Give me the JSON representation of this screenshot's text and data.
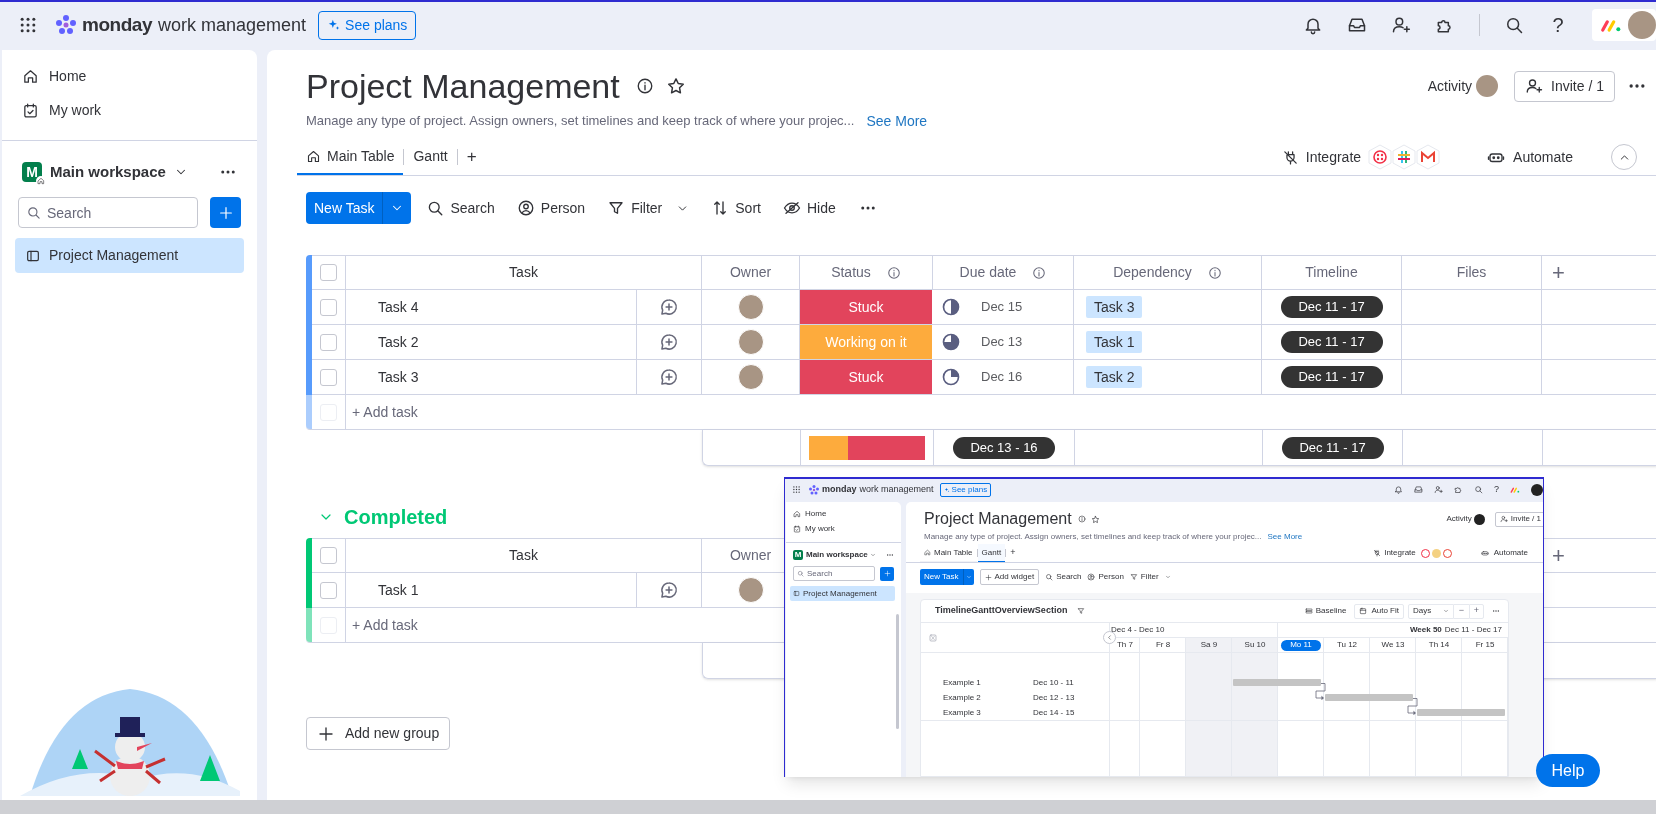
{
  "topbar": {
    "brand": "monday",
    "product": "work management",
    "see_plans": "See plans",
    "help": "?"
  },
  "sidebar": {
    "nav": [
      {
        "kind": "home",
        "label": "Home"
      },
      {
        "kind": "mywork",
        "label": "My work"
      }
    ],
    "workspace": {
      "badge": "M",
      "name": "Main workspace"
    },
    "search": {
      "placeholder": "Search"
    },
    "boards": [
      {
        "label": "Project Management",
        "selected": true
      }
    ]
  },
  "board": {
    "title": "Project Management",
    "description": "Manage any type of project. Assign owners, set timelines and keep track of where your projec...",
    "see_more": "See More",
    "activity": "Activity",
    "invite": "Invite / 1",
    "tabs": [
      {
        "label": "Main Table",
        "selected": true
      },
      {
        "label": "Gantt",
        "selected": false
      }
    ],
    "add_tab": "+",
    "integrate": "Integrate",
    "automate": "Automate",
    "toolbar": {
      "new_task": "New Task",
      "actions": [
        {
          "kind": "search",
          "label": "Search"
        },
        {
          "kind": "person",
          "label": "Person"
        },
        {
          "kind": "filter",
          "label": "Filter"
        },
        {
          "kind": "sort",
          "label": "Sort"
        },
        {
          "kind": "hide",
          "label": "Hide"
        }
      ]
    }
  },
  "groups": [
    {
      "color": "#579bfc",
      "checked": false,
      "add_row_checkbox_disabled": true,
      "columns": [
        {
          "kind": "task",
          "label": "Task",
          "info": false
        },
        {
          "kind": "owner",
          "label": "Owner",
          "info": false
        },
        {
          "kind": "status",
          "label": "Status",
          "info": true
        },
        {
          "kind": "date",
          "label": "Due date",
          "info": true
        },
        {
          "kind": "dependency",
          "label": "Dependency",
          "info": true
        },
        {
          "kind": "timeline",
          "label": "Timeline",
          "info": false
        },
        {
          "kind": "files",
          "label": "Files",
          "info": false
        }
      ],
      "add_column": "+",
      "rows": [
        {
          "task": "Task 4",
          "checked": false,
          "status": {
            "label": "Stuck",
            "color": "#e2445c"
          },
          "date": {
            "text": "Dec 15",
            "kind": "half"
          },
          "dependency": "Task 3",
          "timeline": "Dec 11 - 17"
        },
        {
          "task": "Task 2",
          "checked": false,
          "status": {
            "label": "Working on it",
            "color": "#fdab3d"
          },
          "date": {
            "text": "Dec 13",
            "kind": "threequarters"
          },
          "dependency": "Task 1",
          "timeline": "Dec 11 - 17"
        },
        {
          "task": "Task 3",
          "checked": false,
          "status": {
            "label": "Stuck",
            "color": "#e2445c"
          },
          "date": {
            "text": "Dec 16",
            "kind": "quarter"
          },
          "dependency": "Task 2",
          "timeline": "Dec 11 - 17"
        }
      ],
      "add_task": "+ Add task",
      "summary": {
        "date": "Dec 13 - 16",
        "timeline": "Dec 11 - 17"
      }
    },
    {
      "title": "Completed",
      "color": "#00c875",
      "checked": false,
      "add_row_checkbox_disabled": true,
      "columns": [
        {
          "kind": "task",
          "label": "Task",
          "info": false
        },
        {
          "kind": "owner",
          "label": "Owner",
          "info": false
        }
      ],
      "add_column": "+",
      "rows": [
        {
          "task": "Task 1",
          "checked": false
        }
      ],
      "add_task": "+ Add task"
    }
  ],
  "add_group": "Add new group",
  "help": "Help",
  "inset": {
    "topbar": {
      "brand": "monday",
      "product": "work management",
      "see_plans": "See plans",
      "help": "?"
    },
    "sidebar": {
      "nav": [
        {
          "kind": "home",
          "label": "Home"
        },
        {
          "kind": "mywork",
          "label": "My work"
        }
      ],
      "workspace": {
        "badge": "M",
        "name": "Main workspace"
      },
      "search": {
        "placeholder": "Search"
      },
      "boards": [
        {
          "label": "Project Management",
          "selected": true
        }
      ]
    },
    "board": {
      "title": "Project Management",
      "description": "Manage any type of project. Assign owners, set timelines and keep track of where your projec...",
      "see_more": "See More",
      "activity": "Activity",
      "invite": "Invite / 1",
      "tabs": [
        {
          "label": "Main Table",
          "selected": false
        },
        {
          "label": "Gantt",
          "selected": true
        }
      ],
      "add_tab": "+",
      "integrate": "Integrate",
      "automate": "Automate",
      "toolbar": {
        "new_task": "New Task",
        "add_widget": "Add widget",
        "actions": [
          {
            "kind": "search",
            "label": "Search"
          },
          {
            "kind": "person",
            "label": "Person"
          },
          {
            "kind": "filter",
            "label": "Filter"
          }
        ]
      }
    },
    "gantt": {
      "title": "TimelineGanttOverviewSection",
      "baseline": "Baseline",
      "auto_fit": "Auto Fit",
      "scale": "Days",
      "zoom_out": "−",
      "zoom_in": "+",
      "weeks": [
        {
          "label": "Dec 4 - Dec 10"
        },
        {
          "week": "Week 50",
          "label": "Dec 11 - Dec 17"
        }
      ],
      "days": [
        {
          "label": "Th 7",
          "selected": false,
          "weekend": false
        },
        {
          "label": "Fr 8",
          "selected": false,
          "weekend": false
        },
        {
          "label": "Sa 9",
          "selected": false,
          "weekend": true
        },
        {
          "label": "Su 10",
          "selected": false,
          "weekend": true
        },
        {
          "label": "Mo 11",
          "selected": true,
          "weekend": false
        },
        {
          "label": "Tu 12",
          "selected": false,
          "weekend": false
        },
        {
          "label": "We 13",
          "selected": false,
          "weekend": false
        },
        {
          "label": "Th 14",
          "selected": false,
          "weekend": false
        },
        {
          "label": "Fr 15",
          "selected": false,
          "weekend": false
        }
      ],
      "items": [
        {
          "name": "Example 1",
          "dates": "Dec 10 - 11"
        },
        {
          "name": "Example 2",
          "dates": "Dec 12 - 13"
        },
        {
          "name": "Example 3",
          "dates": "Dec 14 - 15"
        }
      ]
    }
  }
}
